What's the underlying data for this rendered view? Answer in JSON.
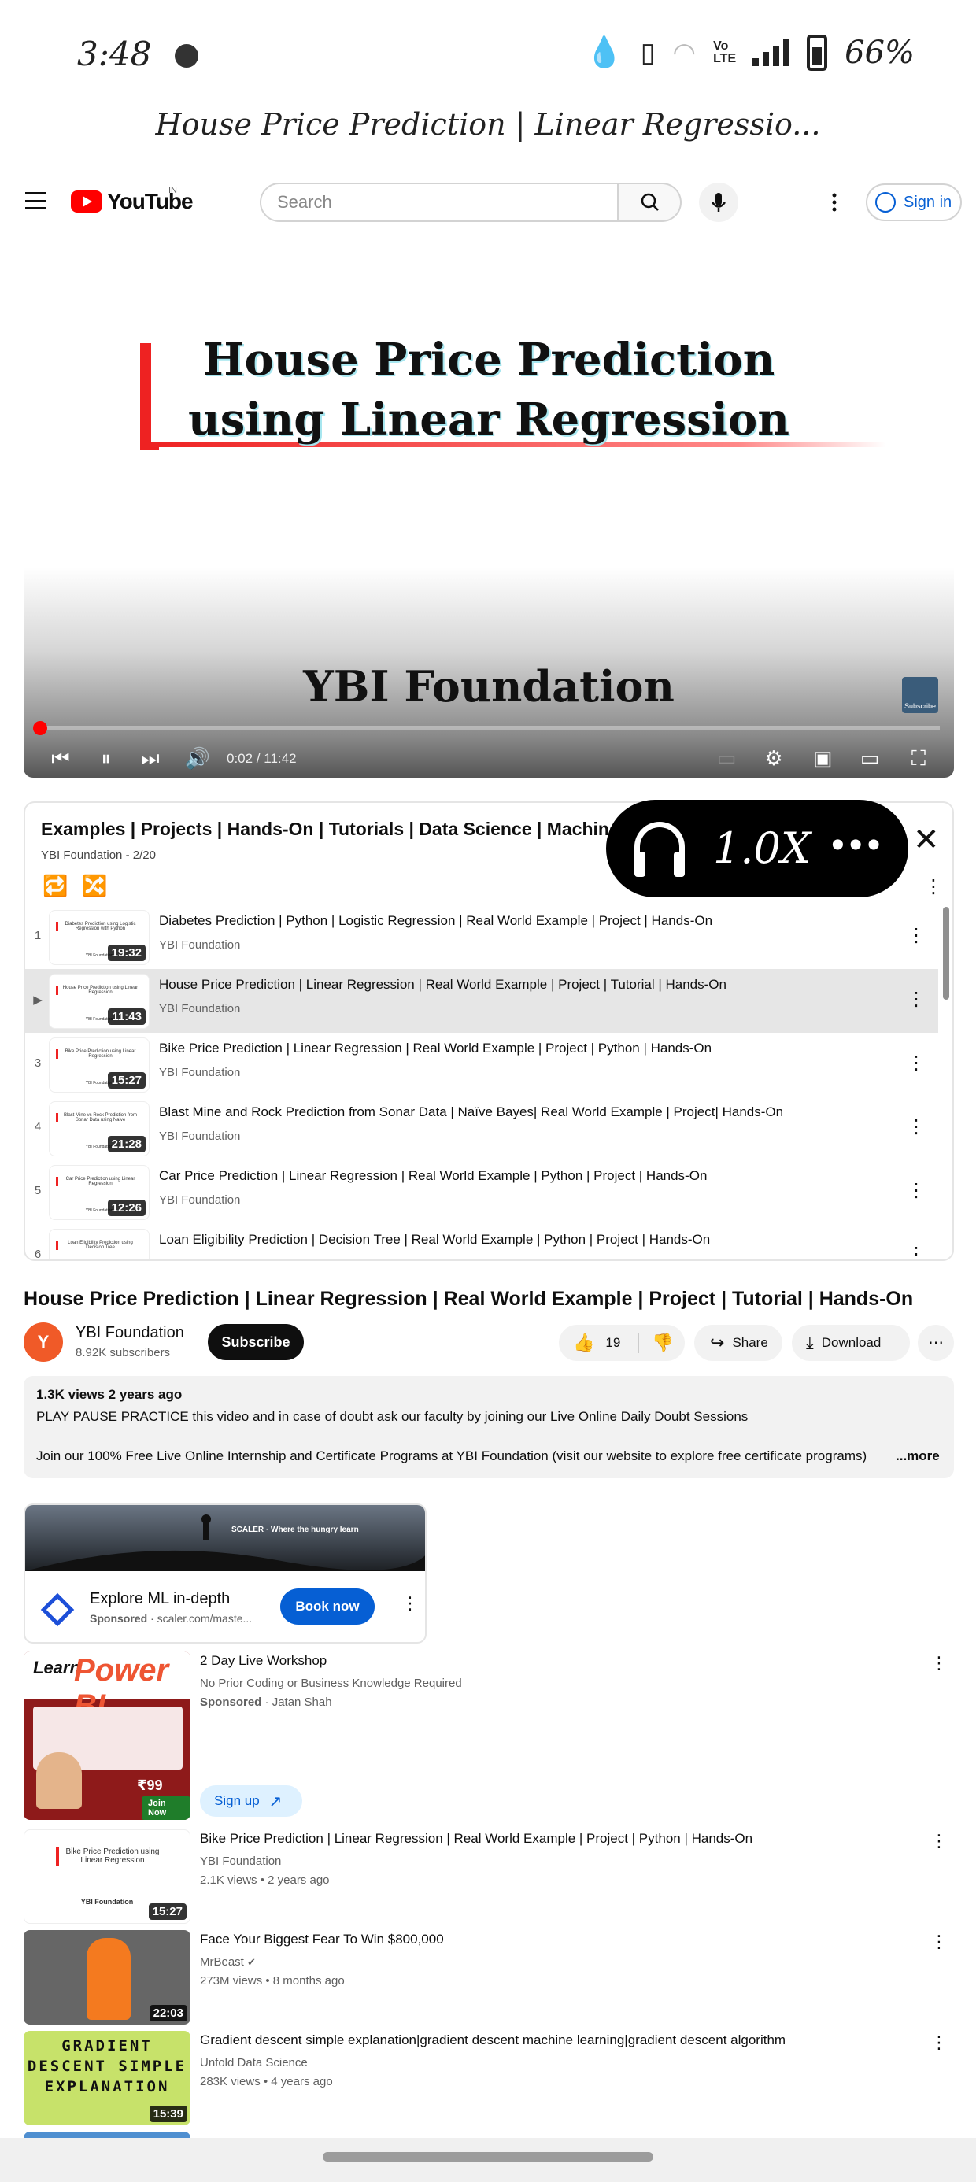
{
  "status_bar": {
    "time": "3:48",
    "volte": "Vo LTE",
    "battery": "66%"
  },
  "page_title": "House Price Prediction | Linear Regressio...",
  "header": {
    "logo_text": "YouTube",
    "region": "IN",
    "search_placeholder": "Search",
    "sign_in": "Sign in"
  },
  "player": {
    "title_line1": "House Price Prediction",
    "title_line2": "using Linear Regression",
    "brand": "YBI Foundation",
    "watermark": "Subscribe",
    "time": "0:02 / 11:42",
    "progress": 0.003,
    "colors": {
      "accent": "#ff0000",
      "progress_track": "#ffffff"
    }
  },
  "overlay": {
    "speed": "1.0X",
    "icon": "headphones-icon"
  },
  "playlist": {
    "title": "Examples | Projects | Hands-On | Tutorials | Data Science | Machine Learning",
    "subtitle": "YBI Foundation - 2/20",
    "items": [
      {
        "index": "1",
        "title": "Diabetes Prediction | Python | Logistic Regression | Real World Example | Project | Hands-On",
        "channel": "YBI Foundation",
        "duration": "19:32",
        "thumb": "Diabetes Prediction using Logistic Regression with Python",
        "active": false
      },
      {
        "index": "▶",
        "title": "House Price Prediction | Linear Regression | Real World Example | Project | Tutorial | Hands-On",
        "channel": "YBI Foundation",
        "duration": "11:43",
        "thumb": "House Price Prediction using Linear Regression",
        "active": true
      },
      {
        "index": "3",
        "title": "Bike Price Prediction | Linear Regression | Real World Example | Project | Python | Hands-On",
        "channel": "YBI Foundation",
        "duration": "15:27",
        "thumb": "Bike Price Prediction using Linear Regression",
        "active": false
      },
      {
        "index": "4",
        "title": "Blast Mine and Rock Prediction from Sonar Data | Naïve Bayes| Real World Example | Project| Hands-On",
        "channel": "YBI Foundation",
        "duration": "21:28",
        "thumb": "Blast Mine vs Rock Prediction from Sonar Data using Naive",
        "active": false
      },
      {
        "index": "5",
        "title": "Car Price Prediction | Linear Regression | Real World Example | Python | Project | Hands-On",
        "channel": "YBI Foundation",
        "duration": "12:26",
        "thumb": "Car Price Prediction using Linear Regression",
        "active": false
      },
      {
        "index": "6",
        "title": "Loan Eligibility Prediction | Decision Tree | Real World Example | Python | Project | Hands-On",
        "channel": "YBI Foundation",
        "duration": "",
        "thumb": "Loan Eligibility Prediction using Decision Tree",
        "active": false
      }
    ]
  },
  "video": {
    "title": "House Price Prediction | Linear Regression | Real World Example | Project | Tutorial | Hands-On",
    "channel": "YBI Foundation",
    "subscribers": "8.92K subscribers",
    "subscribe": "Subscribe",
    "likes": "19",
    "share": "Share",
    "download": "Download"
  },
  "description": {
    "meta": "1.3K views  2 years ago",
    "line1": "PLAY PAUSE PRACTICE this video and in case of doubt ask our faculty by joining our Live Online Daily Doubt Sessions",
    "line2": "Join our 100% Free Live Online Internship and Certificate Programs  at YBI Foundation (visit our website to explore free certificate programs)",
    "more": "...more"
  },
  "ad": {
    "banner_text": "SCALER · Where the hungry learn",
    "title": "Explore ML in-depth",
    "sponsored": "Sponsored",
    "url": "scaler.com/maste...",
    "cta": "Book now"
  },
  "recommendations": [
    {
      "title": "2 Day Live Workshop",
      "sub1": "No Prior Coding or Business Knowledge Required",
      "sub2_a": "Sponsored",
      "sub2_b": "Jatan Shah",
      "cta": "Sign up",
      "thumb_learn": "Learn",
      "thumb_big": "Power BI",
      "thumb_price": "₹99",
      "thumb_join": "Join Now"
    },
    {
      "title": "Bike Price Prediction | Linear Regression | Real World Example | Project | Python | Hands-On",
      "channel": "YBI Foundation",
      "meta": "2.1K views  •  2 years ago",
      "duration": "15:27",
      "thumb_text": "Bike Price Prediction using Linear Regression",
      "thumb_foot": "YBI Foundation"
    },
    {
      "title": "Face Your Biggest Fear To Win $800,000",
      "channel": "MrBeast",
      "meta": "273M views  •  8 months ago",
      "duration": "22:03"
    },
    {
      "title": "Gradient descent simple explanation|gradient descent machine learning|gradient descent algorithm",
      "channel": "Unfold Data Science",
      "meta": "283K views  •  4 years ago",
      "duration": "15:39",
      "thumb_text": "GRADIENT DESCENT SIMPLE EXPLANATION"
    }
  ]
}
